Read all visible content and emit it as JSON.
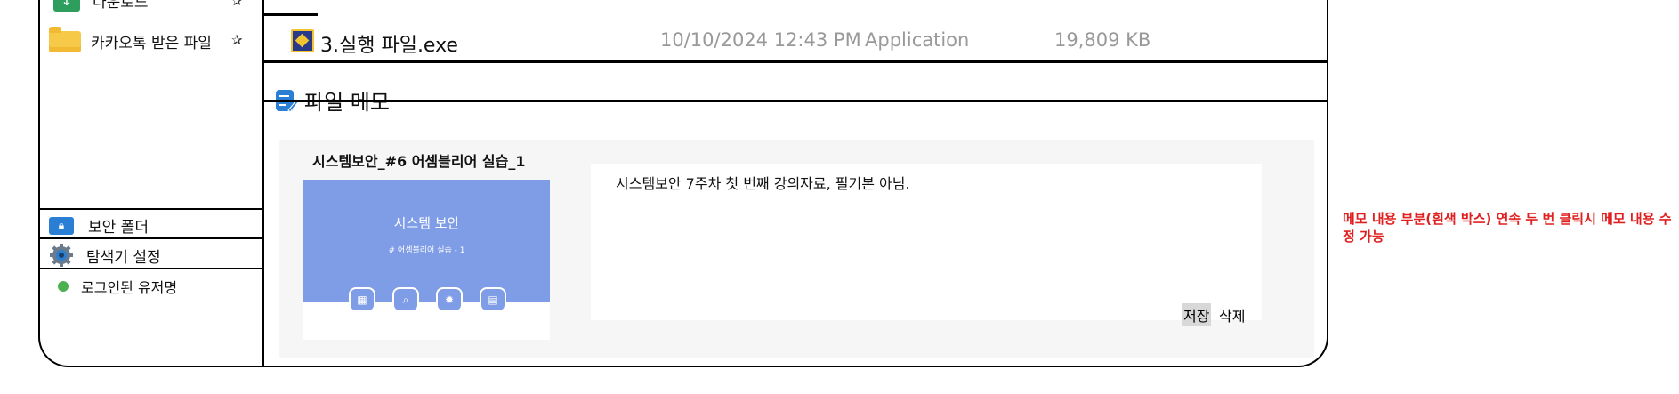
{
  "sidebar": {
    "items": [
      {
        "label": "다운로드",
        "icon": "download-icon"
      },
      {
        "label": "카카오톡 받은 파일",
        "icon": "folder-icon"
      }
    ],
    "bottom": [
      {
        "label": "보안 폴더",
        "icon": "lock-folder-icon"
      },
      {
        "label": "탐색기 설정",
        "icon": "gear-icon"
      },
      {
        "label": "로그인된 유저명",
        "icon": "online-status-dot"
      }
    ]
  },
  "file": {
    "name": "3.실행 파일.exe",
    "date": "10/10/2024 12:43 PM",
    "type": "Application",
    "size": "19,809 KB"
  },
  "memo": {
    "header": "파일 메모",
    "thumbnail_title": "시스템보안_#6 어셈블리어 실습_1",
    "slide_title": "시스템 보안",
    "slide_subtitle": "# 어셈블리어 실습 - 1",
    "text": "시스템보안 7주차 첫 번째 강의자료, 필기본 아님.",
    "save_label": "저장",
    "delete_label": "삭제"
  },
  "annotation": "메모 내용 부분(흰색 박스) 연속 두 번 클릭시 메모 내용 수정 가능",
  "colors": {
    "accent": "#2a7fd4",
    "slide": "#7f9ce6",
    "annotation": "#e02020",
    "online": "#4caf50"
  }
}
